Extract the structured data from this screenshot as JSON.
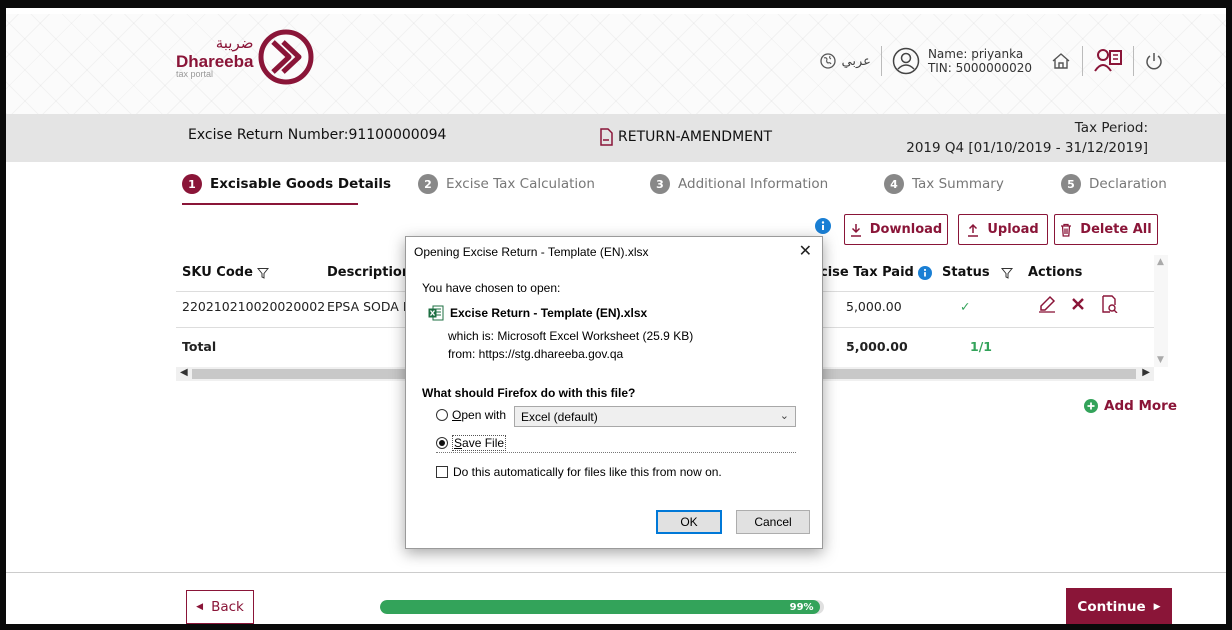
{
  "colors": {
    "brand": "#8a1538",
    "success": "#33a35a",
    "infobar": "#e4e4e4"
  },
  "header": {
    "logo": {
      "arabic": "ضريبة",
      "english": "Dhareeba",
      "sub": "tax portal"
    },
    "language_label": "عربي",
    "user": {
      "name_line": "Name: priyanka",
      "tin_line": "TIN: 5000000020"
    },
    "icons": [
      "globe-icon",
      "user-circle-icon",
      "home-icon",
      "users-icon",
      "power-icon"
    ]
  },
  "infobar": {
    "return_number": "Excise Return Number:91100000094",
    "return_type": "RETURN-AMENDMENT",
    "tax_period_label": "Tax Period:",
    "tax_period_value": "2019 Q4 [01/10/2019 - 31/12/2019]"
  },
  "steps": [
    {
      "num": "1",
      "label": "Excisable Goods Details"
    },
    {
      "num": "2",
      "label": "Excise Tax Calculation"
    },
    {
      "num": "3",
      "label": "Additional Information"
    },
    {
      "num": "4",
      "label": "Tax Summary"
    },
    {
      "num": "5",
      "label": "Declaration"
    }
  ],
  "toolbar": {
    "download": "Download",
    "upload": "Upload",
    "delete_all": "Delete All"
  },
  "table": {
    "headers": {
      "sku": "SKU Code",
      "description": "Description",
      "excise_tax_paid": "cise Tax Paid",
      "status": "Status",
      "actions": "Actions"
    },
    "rows": [
      {
        "sku": "220210210020020002",
        "description": "EPSA SODA L",
        "excise_tax_paid": "5,000.00",
        "status": "✓"
      }
    ],
    "total": {
      "label": "Total",
      "excise_tax_paid": "5,000.00",
      "status": "1/1"
    }
  },
  "add_more": "Add More",
  "footer": {
    "back": "Back",
    "progress_label": "99%",
    "progress_value": 0.99,
    "continue": "Continue"
  },
  "dialog": {
    "title": "Opening Excise Return - Template (EN).xlsx",
    "chosen": "You have chosen to open:",
    "file_name": "Excise Return - Template (EN).xlsx",
    "which_is": "which is: Microsoft Excel Worksheet (25.9 KB)",
    "from": "from: https://stg.dhareeba.gov.qa",
    "question": "What should Firefox do with this file?",
    "open_with_label": "Open with",
    "open_with_value": "Excel (default)",
    "save_file_label": "Save File",
    "auto_label": "Do this automatically for files like this from now on.",
    "ok": "OK",
    "cancel": "Cancel"
  }
}
